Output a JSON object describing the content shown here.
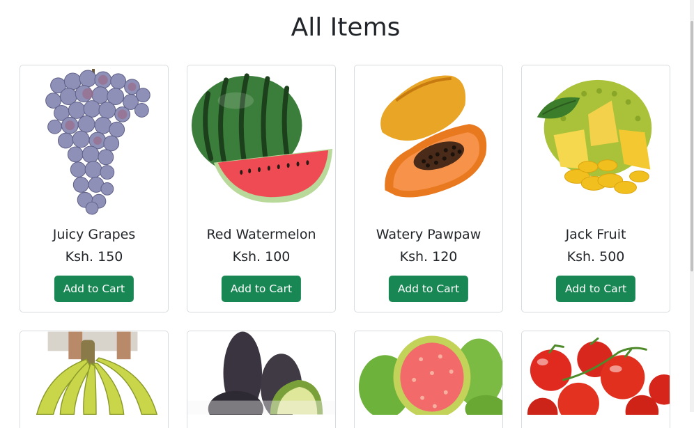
{
  "page": {
    "title": "All Items"
  },
  "items": [
    {
      "name": "Juicy Grapes",
      "price": "Ksh. 150",
      "button": "Add to Cart",
      "image": "grapes"
    },
    {
      "name": "Red Watermelon",
      "price": "Ksh. 100",
      "button": "Add to Cart",
      "image": "watermelon"
    },
    {
      "name": "Watery Pawpaw",
      "price": "Ksh. 120",
      "button": "Add to Cart",
      "image": "pawpaw"
    },
    {
      "name": "Jack Fruit",
      "price": "Ksh. 500",
      "button": "Add to Cart",
      "image": "jackfruit"
    }
  ],
  "partial_items": [
    {
      "image": "bananas"
    },
    {
      "image": "avocado"
    },
    {
      "image": "guava"
    },
    {
      "image": "tomatoes"
    }
  ],
  "colors": {
    "button": "#198754",
    "card_border": "#d9dcdf",
    "text": "#212529"
  }
}
